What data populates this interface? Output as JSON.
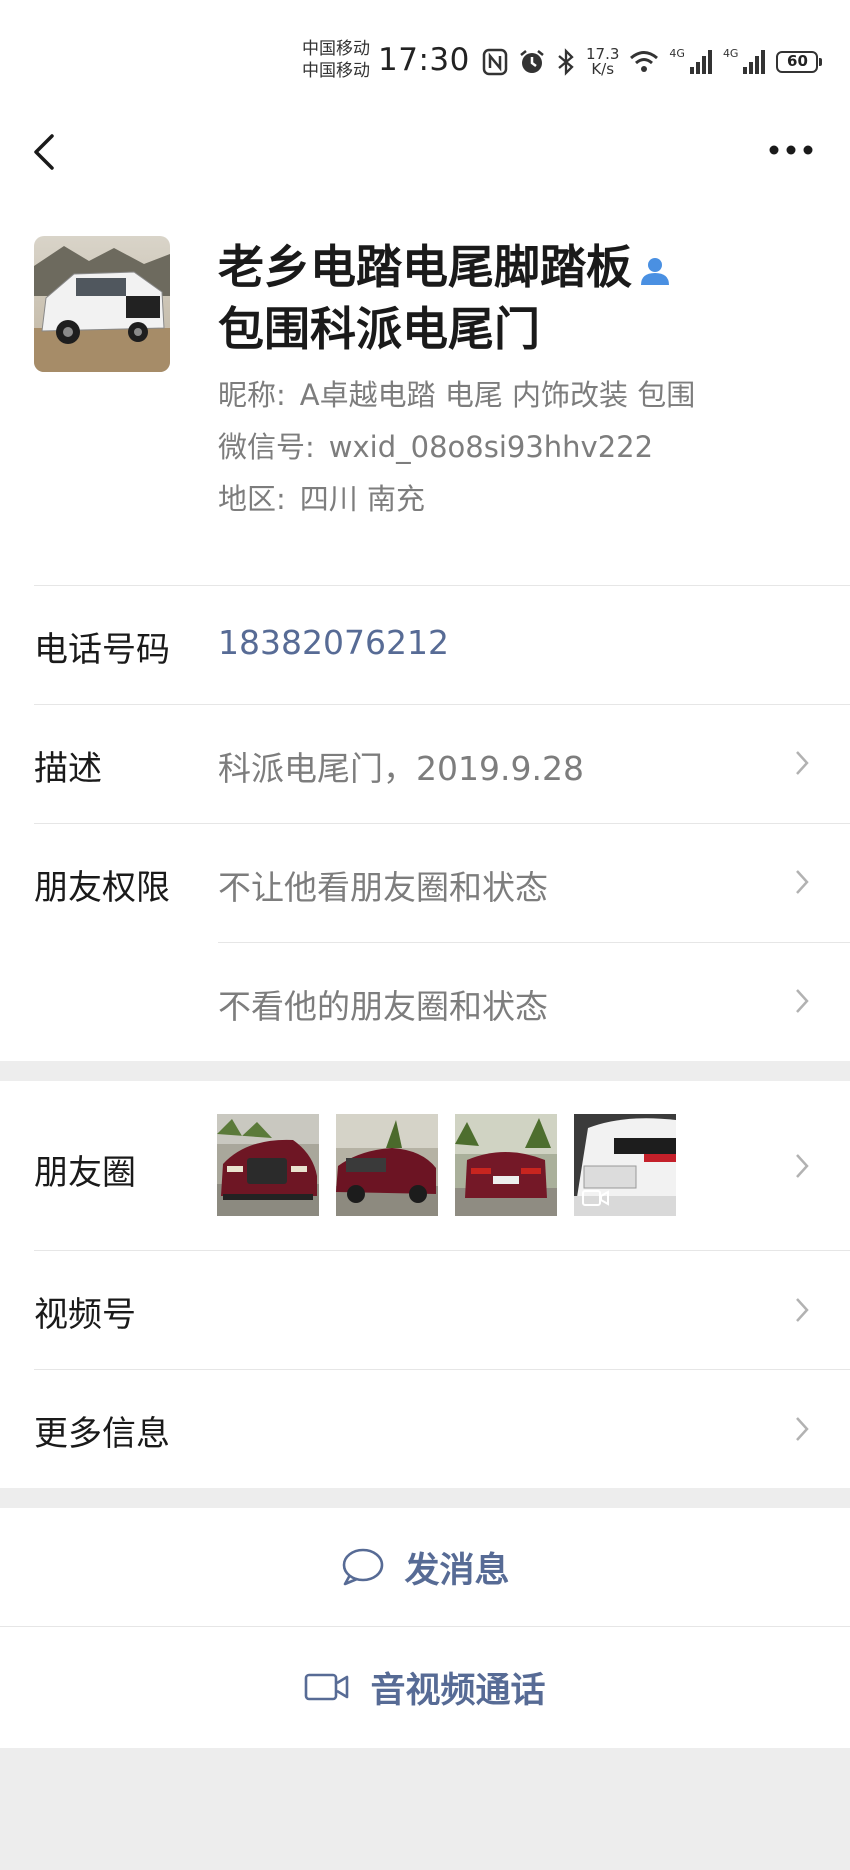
{
  "status_bar": {
    "carrier_1": "中国移动",
    "carrier_2": "中国移动",
    "time": "17:30",
    "speed_value": "17.3",
    "speed_unit": "K/s",
    "network_1": "4G",
    "network_2": "4G",
    "battery": "60"
  },
  "profile": {
    "name_line_1": "老乡电踏电尾脚踏板",
    "name_line_2": "包围科派电尾门",
    "nickname_label": "昵称:",
    "nickname_value": "A卓越电踏 电尾 内饰改装  包围",
    "wechat_id_label": "微信号:",
    "wechat_id_value": "wxid_08o8si93hhv222",
    "region_label": "地区:",
    "region_value": "四川  南充"
  },
  "rows": {
    "phone_label": "电话号码",
    "phone_value": "18382076212",
    "description_label": "描述",
    "description_value": "科派电尾门，2019.9.28",
    "permissions_label": "朋友权限",
    "permission_1": "不让他看朋友圈和状态",
    "permission_2": "不看他的朋友圈和状态",
    "moments_label": "朋友圈",
    "channels_label": "视频号",
    "more_info_label": "更多信息"
  },
  "actions": {
    "message": "发消息",
    "call": "音视频通话"
  },
  "colors": {
    "link_blue": "#576b95",
    "secondary_text": "#7d7d7d",
    "section_gap": "#ededed",
    "friend_icon": "#4a90e2"
  },
  "icons": [
    "back-arrow-icon",
    "more-icon",
    "friend-badge-icon",
    "chevron-right-icon",
    "chat-bubble-icon",
    "video-camera-icon",
    "video-badge-icon"
  ]
}
